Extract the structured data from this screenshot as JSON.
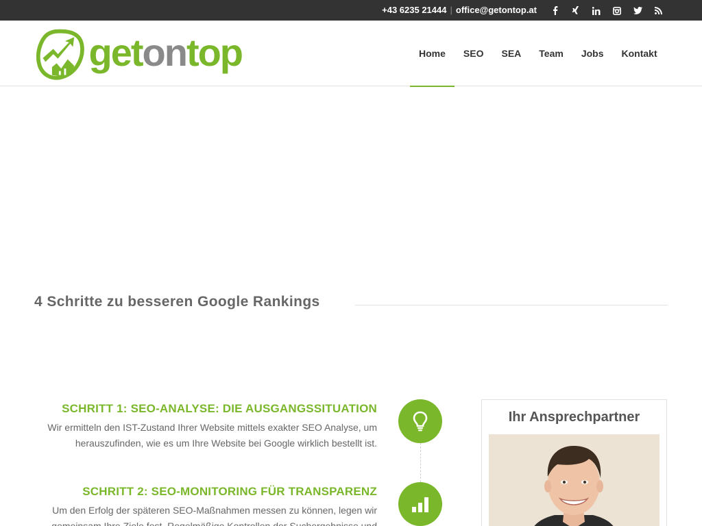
{
  "topbar": {
    "phone": "+43 6235 21444",
    "separator": "|",
    "email": "office@getontop.at",
    "social": [
      {
        "icon": "facebook-icon",
        "glyph": "f"
      },
      {
        "icon": "xing-icon",
        "glyph": "x"
      },
      {
        "icon": "linkedin-icon",
        "glyph": "in"
      },
      {
        "icon": "instagram-icon",
        "glyph": "ig"
      },
      {
        "icon": "twitter-icon",
        "glyph": "tw"
      },
      {
        "icon": "rss-icon",
        "glyph": "rss"
      }
    ]
  },
  "logo": {
    "word_part1": "get",
    "word_part2": "on",
    "word_part3": "top"
  },
  "nav": {
    "items": [
      {
        "label": "Home",
        "active": true
      },
      {
        "label": "SEO",
        "active": false
      },
      {
        "label": "SEA",
        "active": false
      },
      {
        "label": "Team",
        "active": false
      },
      {
        "label": "Jobs",
        "active": false
      },
      {
        "label": "Kontakt",
        "active": false
      }
    ]
  },
  "hero": {
    "heading": "4 Schritte zu besseren Google Rankings"
  },
  "steps": [
    {
      "title": "SCHRITT 1: SEO-ANALYSE: DIE AUSGANGSSITUATION",
      "text": "Wir ermitteln den IST-Zustand Ihrer Website mittels exakter SEO Analyse, um herauszufinden, wie es um Ihre Website bei Google wirklich bestellt ist.",
      "icon": "lightbulb-icon"
    },
    {
      "title": "SCHRITT 2: SEO-MONITORING FÜR TRANSPARENZ",
      "text": "Um den Erfolg der späteren SEO-Maßnahmen messen zu können, legen wir gemeinsam Ihre Ziele fest. Regelmäßige Kontrollen der Suchergebnisse und",
      "icon": "bar-chart-icon"
    }
  ],
  "sidebar": {
    "title": "Ihr Ansprechpartner"
  },
  "colors": {
    "accent": "#7ab72a",
    "topbar": "#333333",
    "text": "#666666"
  }
}
